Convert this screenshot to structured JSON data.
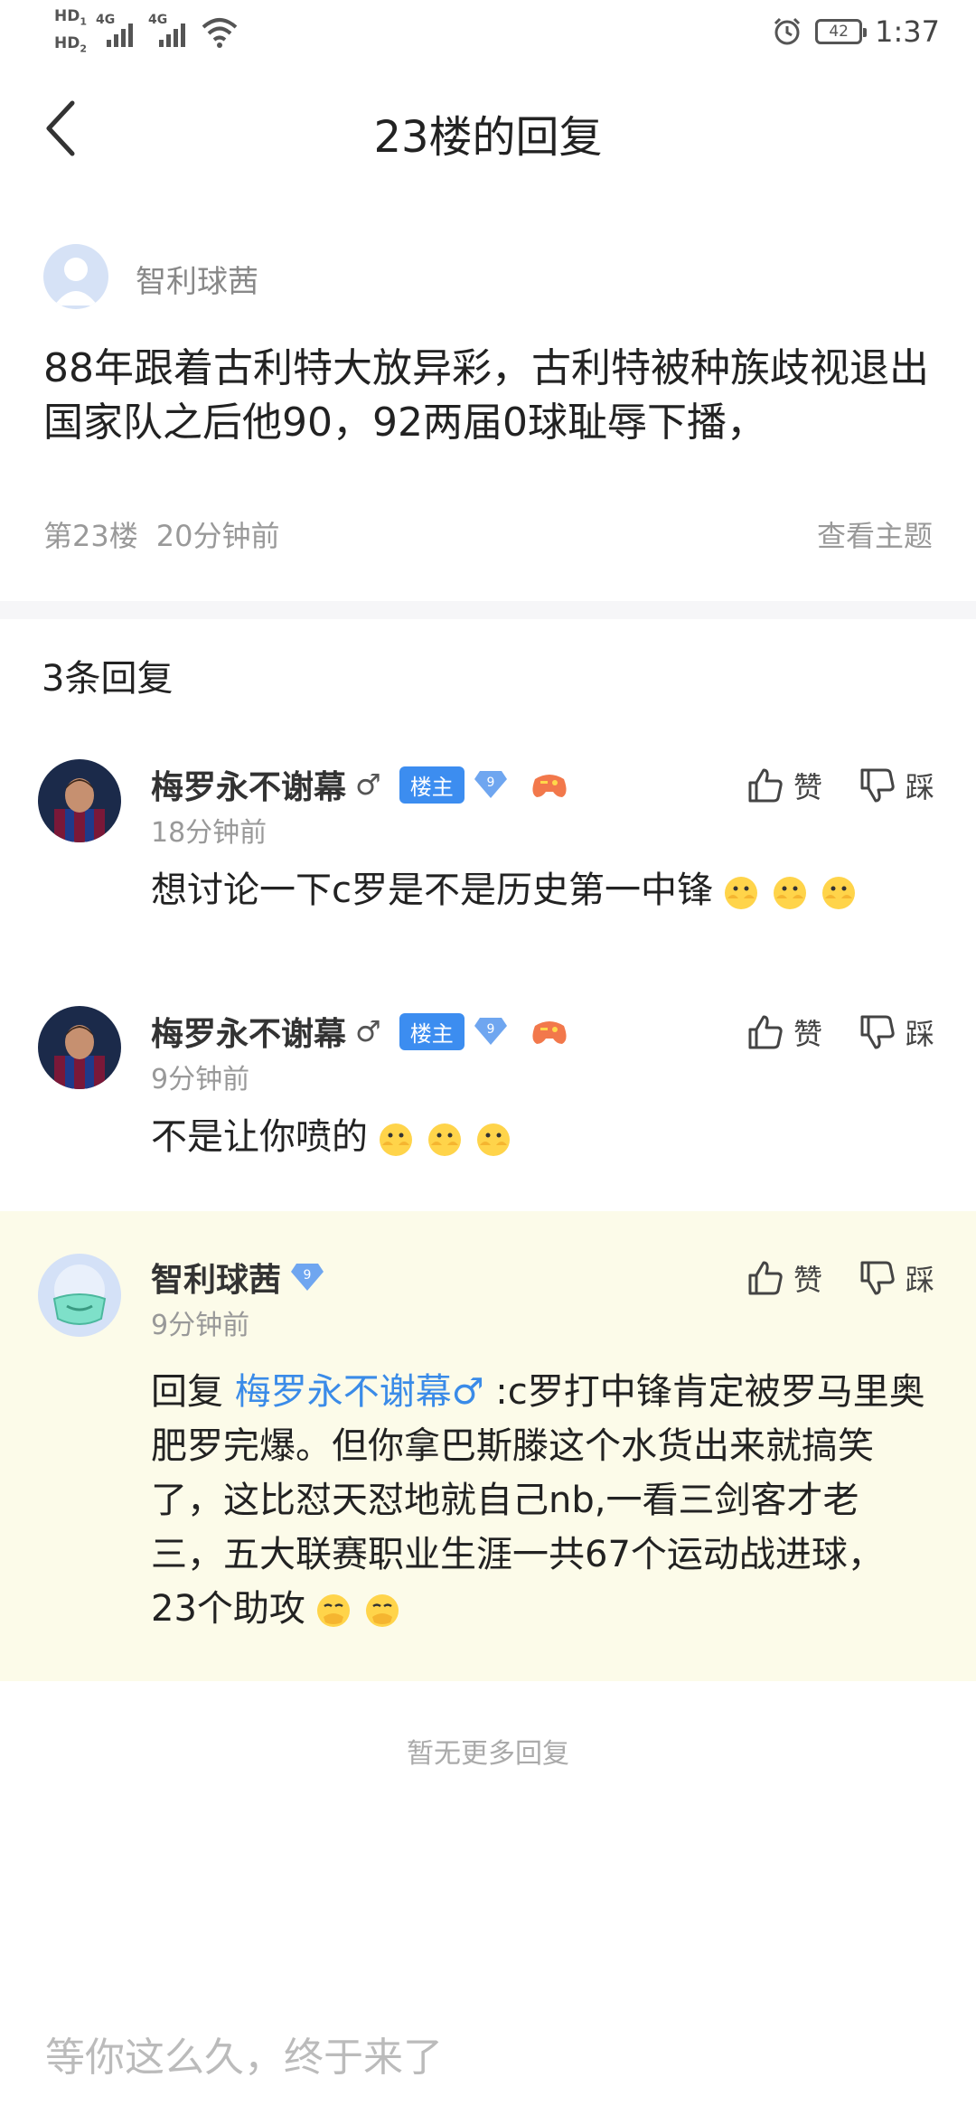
{
  "status_bar": {
    "hd1": "HD",
    "hd1_sub": "1",
    "hd2": "HD",
    "hd2_sub": "2",
    "net1": "4G",
    "net2": "4G",
    "battery": "42",
    "time": "1:37"
  },
  "header": {
    "title": "23楼的回复"
  },
  "post": {
    "author": "智利球茜",
    "body": "88年跟着古利特大放异彩，古利特被种族歧视退出国家队之后他90，92两届0球耻辱下播，",
    "floor": "第23楼",
    "time": "20分钟前",
    "view_topic": "查看主题"
  },
  "replies_header": "3条回复",
  "replies": [
    {
      "name": "梅罗永不谢幕",
      "gender": "♂",
      "owner_badge": "楼主",
      "level": "9",
      "time": "18分钟前",
      "text": "想讨论一下c罗是不是历史第一中锋",
      "like": "赞",
      "dislike": "踩"
    },
    {
      "name": "梅罗永不谢幕",
      "gender": "♂",
      "owner_badge": "楼主",
      "level": "9",
      "time": "9分钟前",
      "text": "不是让你喷的",
      "like": "赞",
      "dislike": "踩"
    },
    {
      "name": "智利球茜",
      "level": "9",
      "time": "9分钟前",
      "reply_prefix": "回复 ",
      "mention": "梅罗永不谢幕♂",
      "text": " :c罗打中锋肯定被罗马里奥肥罗完爆。但你拿巴斯滕这个水货出来就搞笑了，这比怼天怼地就自己nb,一看三剑客才老三，五大联赛职业生涯一共67个运动战进球，23个助攻",
      "like": "赞",
      "dislike": "踩"
    }
  ],
  "no_more": "暂无更多回复",
  "comment_placeholder": "等你这么久，终于来了"
}
